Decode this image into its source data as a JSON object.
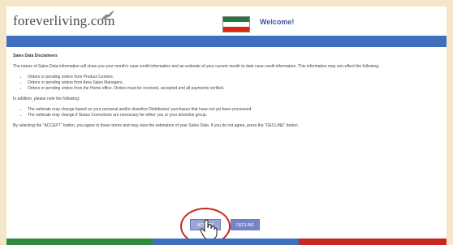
{
  "header": {
    "logo_text": "foreverliving.com",
    "welcome": "Welcome!",
    "flag_colors": [
      "#1f7a3b",
      "#ffffff",
      "#d62612"
    ]
  },
  "content": {
    "heading": "Sales Data Disclaimers",
    "intro": "The nature of Sales Data information will show you your month's case credit information and an estimate of your current month to date case credit information. This information may not reflect the following:",
    "list1": [
      "Orders or pending orders from Product Centers.",
      "Orders or pending orders from Area Sales Managers.",
      "Orders or pending orders from the Home office. Orders must be received, accepted and all payments verified."
    ],
    "addition": "In addition, please note the following:",
    "list2": [
      "The estimate may change based on your personal and/or downline Distributors' purchases that have not yet been processed.",
      "The estimate may change if Status Corrections are necessary for either you or your downline group."
    ],
    "agreement": "By selecting the \"ACCEPT\" button, you agree to these terms and may view the estimation of your Sales Data. If you do not agree, press the \"DECLINE\" button."
  },
  "buttons": {
    "accept": "ACCEPT",
    "decline": "DECLINE"
  },
  "colors": {
    "header_bar": "#3d6fbe",
    "footer": [
      "#2e8b3e",
      "#3d6fbe",
      "#c8261e"
    ],
    "highlight_circle": "#c8261e"
  }
}
